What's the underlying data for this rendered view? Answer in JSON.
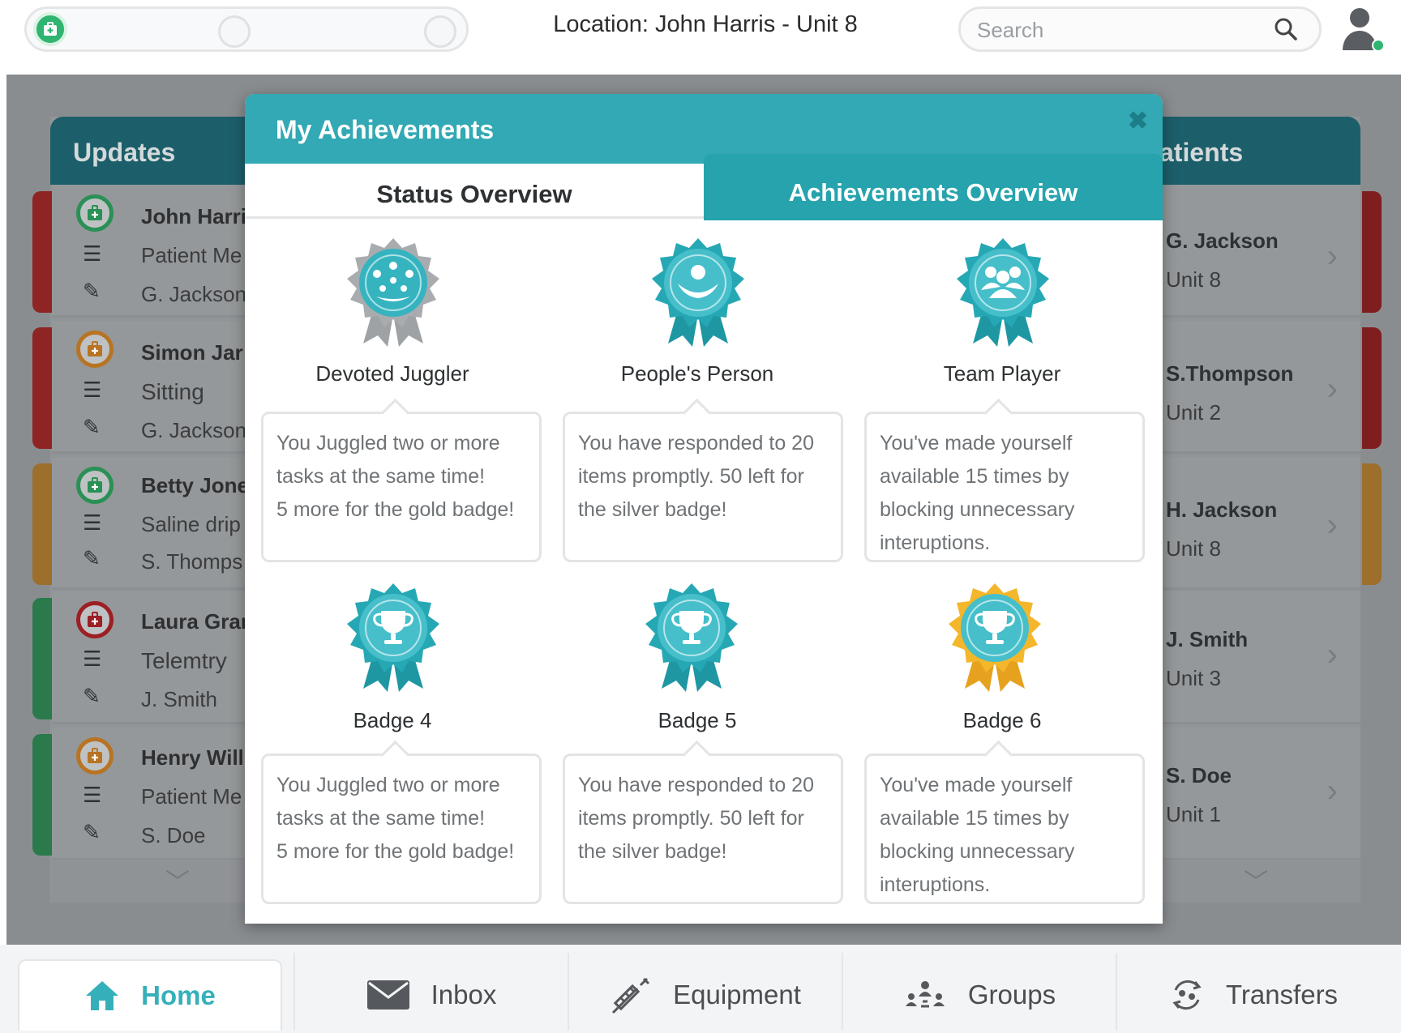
{
  "header": {
    "location": "Location: John Harris - Unit 8",
    "search_placeholder": "Search"
  },
  "updates": {
    "title": "Updates",
    "items": [
      {
        "name": "John Harri",
        "detail": "Patient Me",
        "staff": "G. Jackson",
        "status": "green"
      },
      {
        "name": "Simon Jar",
        "detail": "Sitting",
        "staff": "G. Jackson",
        "status": "orange"
      },
      {
        "name": "Betty Jone",
        "detail": "Saline drip",
        "staff": "S. Thomps",
        "status": "green"
      },
      {
        "name": "Laura Grar",
        "detail": "Telemtry",
        "staff": "J. Smith",
        "status": "red"
      },
      {
        "name": "Henry Willi",
        "detail": "Patient Me",
        "staff": "S. Doe",
        "status": "orange"
      }
    ]
  },
  "patients": {
    "title": "atients",
    "items": [
      {
        "name": "G. Jackson",
        "unit": "Unit 8"
      },
      {
        "name": "S.Thompson",
        "unit": "Unit 2"
      },
      {
        "name": "H. Jackson",
        "unit": "Unit 8"
      },
      {
        "name": "J. Smith",
        "unit": "Unit 3"
      },
      {
        "name": "S. Doe",
        "unit": "Unit 1"
      }
    ]
  },
  "modal": {
    "title": "My Achievements",
    "close_label": "✖",
    "tabs": {
      "status": "Status Overview",
      "achievements": "Achievements Overview"
    },
    "badges": [
      {
        "label": "Devoted Juggler",
        "icon": "juggler-icon",
        "tier": "silver",
        "description": [
          "You Juggled two or more",
          "tasks at the same time!",
          "5 more for the gold badge!"
        ]
      },
      {
        "label": "People's Person",
        "icon": "person-icon",
        "tier": "teal",
        "description": [
          "You have responded to 20",
          "items promptly. 50 left for",
          "the silver badge!"
        ]
      },
      {
        "label": "Team Player",
        "icon": "team-icon",
        "tier": "teal",
        "description": [
          "You've made yourself",
          "available 15 times by",
          "blocking unnecessary",
          "interuptions."
        ]
      },
      {
        "label": "Badge 4",
        "icon": "trophy-icon",
        "tier": "teal",
        "description": [
          "You Juggled two or more",
          "tasks at the same time!",
          "5 more for the gold badge!"
        ]
      },
      {
        "label": "Badge 5",
        "icon": "trophy-icon",
        "tier": "teal",
        "description": [
          "You have responded to 20",
          "items promptly. 50 left for",
          "the silver badge!"
        ]
      },
      {
        "label": "Badge 6",
        "icon": "trophy-icon",
        "tier": "gold",
        "description": [
          "You've made yourself",
          "available 15 times by",
          "blocking unnecessary",
          "interuptions."
        ]
      }
    ]
  },
  "nav": {
    "home": "Home",
    "inbox": "Inbox",
    "equipment": "Equipment",
    "groups": "Groups",
    "transfers": "Transfers"
  },
  "colors": {
    "teal": "#32a9b4",
    "gold": "#f4b62a",
    "silver": "#a9acaf",
    "green": "#2fb56f",
    "orange": "#d68a2a",
    "red": "#b52a2a"
  }
}
